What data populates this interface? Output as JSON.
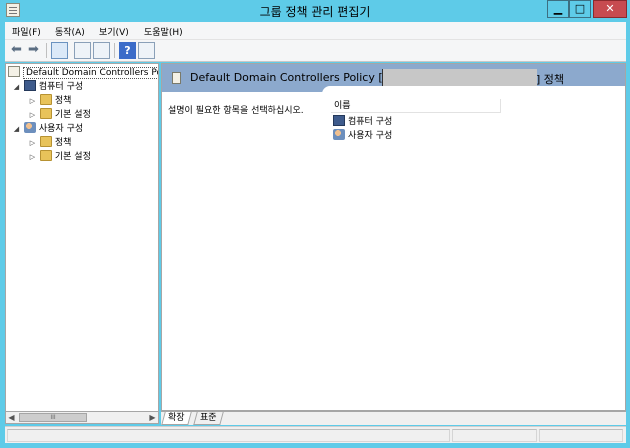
{
  "window": {
    "title": "그룹 정책 관리 편집기",
    "controls": {
      "minimize": "▁",
      "maximize": "□",
      "close": "✕"
    }
  },
  "menu": [
    "파일(F)",
    "동작(A)",
    "보기(V)",
    "도움말(H)"
  ],
  "toolbar": {
    "icons": [
      "back-arrow-icon",
      "forward-arrow-icon",
      "show-hide-console-tree-icon",
      "properties-icon",
      "export-list-icon",
      "help-icon",
      "show-hide-action-pane-icon"
    ],
    "help_glyph": "?"
  },
  "tree": {
    "root": "Default Domain Controllers Po",
    "nodes": [
      {
        "label": "컴퓨터 구성",
        "icon": "computer-icon",
        "expander": "◢",
        "children": [
          {
            "label": "정책",
            "icon": "folder-icon",
            "expander": "▷"
          },
          {
            "label": "기본 설정",
            "icon": "folder-icon",
            "expander": "▷"
          }
        ]
      },
      {
        "label": "사용자 구성",
        "icon": "user-icon",
        "expander": "◢",
        "children": [
          {
            "label": "정책",
            "icon": "folder-icon",
            "expander": "▷"
          },
          {
            "label": "기본 설정",
            "icon": "folder-icon",
            "expander": "▷"
          }
        ]
      }
    ],
    "scroll": {
      "left": "◀",
      "thumb": "III",
      "right": "▶"
    }
  },
  "details": {
    "title": "Default Domain Controllers Policy [",
    "title_suffix": "] 정책",
    "description": "설명이 필요한 항목을 선택하십시오.",
    "column": "이름",
    "items": [
      {
        "label": "컴퓨터 구성",
        "icon": "computer-icon"
      },
      {
        "label": "사용자 구성",
        "icon": "user-icon"
      }
    ]
  },
  "tabs": [
    "확장",
    "표준"
  ],
  "colors": {
    "titlebar": "#5ecbe8",
    "header_band": "#8ca9cd",
    "close_button": "#c74b50"
  }
}
